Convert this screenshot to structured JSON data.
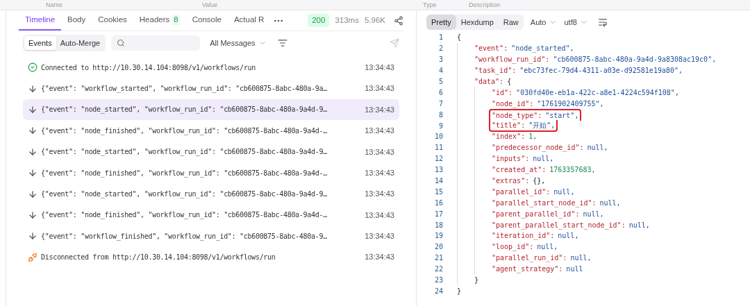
{
  "header_row": {
    "columns": [
      "Name",
      "Value",
      "Type",
      "Description"
    ]
  },
  "response_tabs": [
    {
      "label": "Timeline",
      "selected": true
    },
    {
      "label": "Body",
      "selected": false
    },
    {
      "label": "Cookies",
      "selected": false
    },
    {
      "label": "Headers",
      "count": "8",
      "selected": false
    },
    {
      "label": "Console",
      "selected": false
    },
    {
      "label": "Actual R",
      "selected": false
    }
  ],
  "status": {
    "code": "200",
    "time": "313ms",
    "size": "5.96K"
  },
  "view_modes": [
    {
      "label": "Events",
      "selected": true
    },
    {
      "label": "Auto-Merge",
      "selected": false
    }
  ],
  "filter": {
    "label": "All Messages"
  },
  "events": [
    {
      "kind": "connected",
      "text": "Connected to http://10.30.14.104:8098/v1/workflows/run",
      "time": "13:34:43",
      "selected": false
    },
    {
      "kind": "message",
      "text": "{\"event\": \"workflow_started\", \"workflow_run_id\": \"cb600875-8abc-480a-9a…",
      "time": "13:34:43",
      "selected": false
    },
    {
      "kind": "message",
      "text": "{\"event\": \"node_started\", \"workflow_run_id\": \"cb600875-8abc-480a-9a4d-9…",
      "time": "13:34:43",
      "selected": true
    },
    {
      "kind": "message",
      "text": "{\"event\": \"node_finished\", \"workflow_run_id\": \"cb600875-8abc-480a-9a4d-…",
      "time": "13:34:43",
      "selected": false
    },
    {
      "kind": "message",
      "text": "{\"event\": \"node_started\", \"workflow_run_id\": \"cb600875-8abc-480a-9a4d-9…",
      "time": "13:34:43",
      "selected": false
    },
    {
      "kind": "message",
      "text": "{\"event\": \"node_finished\", \"workflow_run_id\": \"cb600875-8abc-480a-9a4d-…",
      "time": "13:34:43",
      "selected": false
    },
    {
      "kind": "message",
      "text": "{\"event\": \"node_started\", \"workflow_run_id\": \"cb600875-8abc-480a-9a4d-9…",
      "time": "13:34:43",
      "selected": false
    },
    {
      "kind": "message",
      "text": "{\"event\": \"node_finished\", \"workflow_run_id\": \"cb600875-8abc-480a-9a4d-…",
      "time": "13:34:43",
      "selected": false
    },
    {
      "kind": "message",
      "text": "{\"event\": \"workflow_finished\", \"workflow_run_id\": \"cb600875-8abc-480a-9…",
      "time": "13:34:43",
      "selected": false
    },
    {
      "kind": "disconnected",
      "text": "Disconnected from http://10.30.14.104:8098/v1/workflows/run",
      "time": "13:34:43",
      "selected": false
    }
  ],
  "body_modes": [
    {
      "label": "Pretty",
      "selected": true
    },
    {
      "label": "Hexdump",
      "selected": false
    },
    {
      "label": "Raw",
      "selected": false
    }
  ],
  "body_options": [
    {
      "label": "Auto"
    },
    {
      "label": "utf8"
    }
  ],
  "code": [
    {
      "number": "1",
      "kind": "punct",
      "text": "{",
      "children": [
        {
          "number": "2",
          "key": "\"event\":",
          "kind": "string",
          "text": "\"node_started\","
        },
        {
          "number": "3",
          "key": "\"workflow_run_id\":",
          "kind": "string",
          "text": "\"cb600875-8abc-480a-9a4d-9a8308ac19c0\","
        },
        {
          "number": "4",
          "key": "\"task_id\":",
          "kind": "string",
          "text": "\"ebc73fec-79d4-4311-a03e-d92581e19a80\","
        },
        {
          "number": "5",
          "key": "\"data\":",
          "kind": "punct",
          "text": "{",
          "children": [
            {
              "number": "6",
              "key": "\"id\":",
              "kind": "string",
              "text": "\"030fd40e-eb1a-422c-a8e1-4224c594f108\","
            },
            {
              "number": "7",
              "key": "\"node_id\":",
              "kind": "string",
              "text": "\"1761902409755\","
            },
            {
              "number": "8",
              "key": "\"node_type\":",
              "kind": "string",
              "text": "\"start\",",
              "highlighted": true
            },
            {
              "number": "9",
              "key": "\"title\":",
              "kind": "string",
              "text": "\"开始\",",
              "highlighted": true
            },
            {
              "number": "10",
              "key": "\"index\":",
              "kind": "number",
              "text": "1,"
            },
            {
              "number": "11",
              "key": "\"predecessor_node_id\":",
              "kind": "null",
              "text": "null,"
            },
            {
              "number": "12",
              "key": "\"inputs\":",
              "kind": "null",
              "text": "null,"
            },
            {
              "number": "13",
              "key": "\"created_at\":",
              "kind": "number",
              "text": "1763357683,"
            },
            {
              "number": "14",
              "key": "\"extras\":",
              "kind": "punct",
              "text": "{},"
            },
            {
              "number": "15",
              "key": "\"parallel_id\":",
              "kind": "null",
              "text": "null,"
            },
            {
              "number": "16",
              "key": "\"parallel_start_node_id\":",
              "kind": "null",
              "text": "null,"
            },
            {
              "number": "17",
              "key": "\"parent_parallel_id\":",
              "kind": "null",
              "text": "null,"
            },
            {
              "number": "18",
              "key": "\"parent_parallel_start_node_id\":",
              "kind": "null",
              "text": "null,"
            },
            {
              "number": "19",
              "key": "\"iteration_id\":",
              "kind": "null",
              "text": "null,"
            },
            {
              "number": "20",
              "key": "\"loop_id\":",
              "kind": "null",
              "text": "null,"
            },
            {
              "number": "21",
              "key": "\"parallel_run_id\":",
              "kind": "null",
              "text": "null,"
            },
            {
              "number": "22",
              "key": "\"agent_strategy\":",
              "kind": "null",
              "text": "null"
            }
          ]
        },
        {
          "number": "23",
          "kind": "punct",
          "text": "}"
        }
      ]
    },
    {
      "number": "24",
      "kind": "punct",
      "text": "}"
    }
  ]
}
